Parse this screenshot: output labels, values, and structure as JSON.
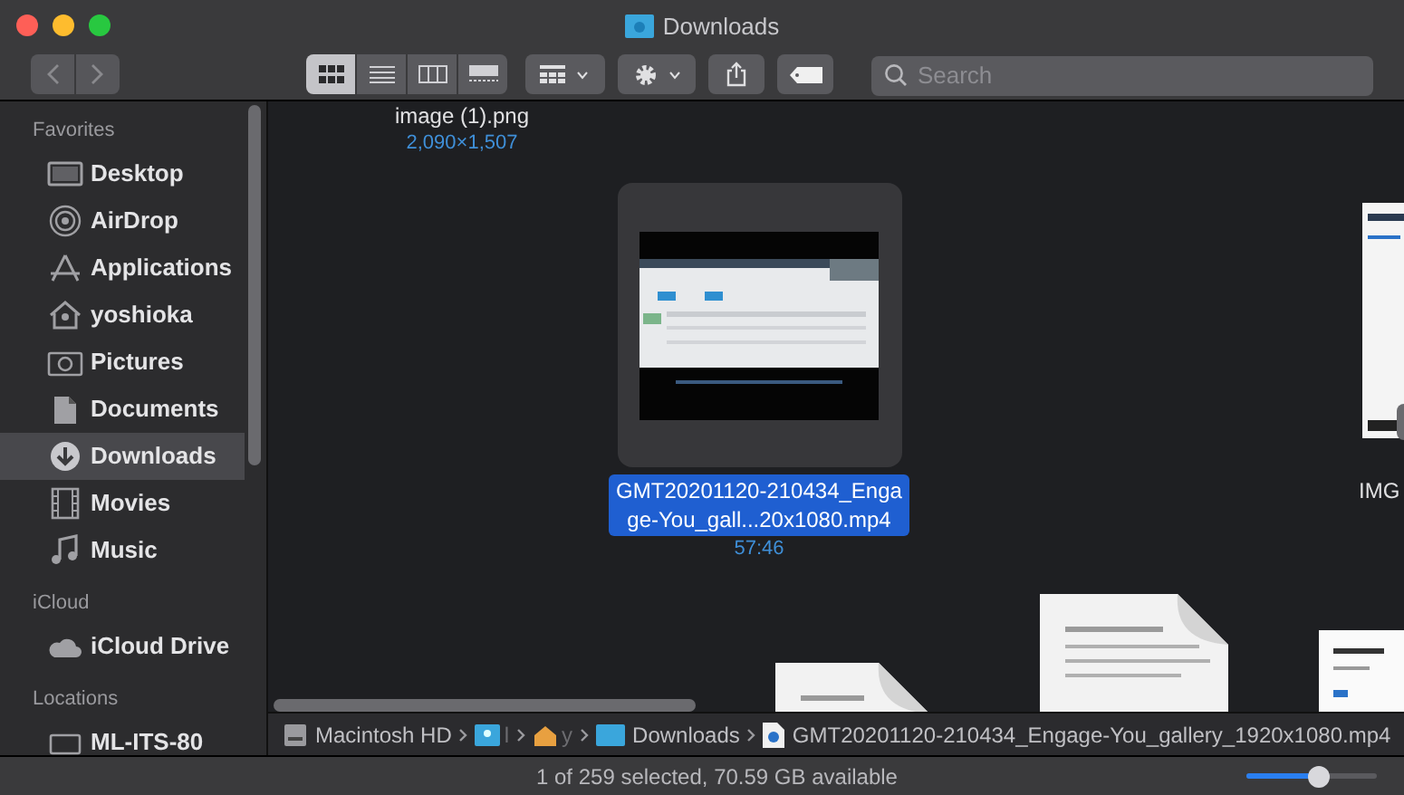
{
  "window": {
    "title": "Downloads"
  },
  "toolbar": {
    "view_modes": [
      {
        "kind": "icons",
        "selected": true
      },
      {
        "kind": "list",
        "selected": false
      },
      {
        "kind": "columns",
        "selected": false
      },
      {
        "kind": "gallery",
        "selected": false
      }
    ],
    "search": {
      "placeholder": "Search"
    }
  },
  "sidebar": {
    "sections": [
      {
        "title": "Favorites",
        "items": [
          {
            "label": "Desktop",
            "kind": "desktop",
            "selected": false
          },
          {
            "label": "AirDrop",
            "kind": "airdrop",
            "selected": false
          },
          {
            "label": "Applications",
            "kind": "apps",
            "selected": false
          },
          {
            "label": "yoshioka",
            "kind": "home",
            "selected": false
          },
          {
            "label": "Pictures",
            "kind": "camera",
            "selected": false
          },
          {
            "label": "Documents",
            "kind": "docs",
            "selected": false
          },
          {
            "label": "Downloads",
            "kind": "download",
            "selected": true
          },
          {
            "label": "Movies",
            "kind": "film",
            "selected": false
          },
          {
            "label": "Music",
            "kind": "music",
            "selected": false
          }
        ]
      },
      {
        "title": "iCloud",
        "items": [
          {
            "label": "iCloud Drive",
            "kind": "cloud",
            "selected": false
          }
        ]
      },
      {
        "title": "Locations",
        "items": [
          {
            "label": "ML-ITS-80",
            "kind": "disk",
            "selected": false
          }
        ]
      }
    ]
  },
  "files": [
    {
      "name": "image (1).png",
      "detail": "2,090×1,507",
      "kind": "cut",
      "selected": false
    },
    {
      "name": "GMT20201120-210434_Engage-You_gall...20x1080.mp4",
      "detail": "57:46",
      "kind": "video",
      "selected": true
    },
    {
      "name": "IMG",
      "kind": "edge",
      "selected": false
    }
  ],
  "path_bar": [
    {
      "label": "Macintosh HD",
      "kind": "disk"
    },
    {
      "label": "l",
      "kind": "user"
    },
    {
      "label": "y",
      "kind": "home"
    },
    {
      "label": "Downloads",
      "kind": "folder"
    },
    {
      "label": "GMT20201120-210434_Engage-You_gallery_1920x1080.mp4",
      "kind": "file"
    }
  ],
  "status_bar": {
    "text": "1 of 259 selected, 70.59 GB available",
    "zoom": {
      "level": 0.55
    }
  }
}
